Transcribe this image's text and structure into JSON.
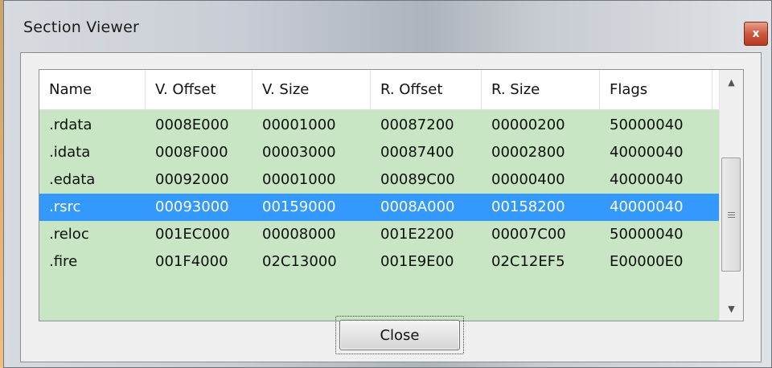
{
  "window": {
    "title": "Section Viewer",
    "close_glyph": "x"
  },
  "table": {
    "columns": [
      "Name",
      "V. Offset",
      "V. Size",
      "R. Offset",
      "R. Size",
      "Flags"
    ],
    "rows": [
      {
        "name": ".rdata",
        "v_offset": "0008E000",
        "v_size": "00001000",
        "r_offset": "00087200",
        "r_size": "00000200",
        "flags": "50000040"
      },
      {
        "name": ".idata",
        "v_offset": "0008F000",
        "v_size": "00003000",
        "r_offset": "00087400",
        "r_size": "00002800",
        "flags": "40000040"
      },
      {
        "name": ".edata",
        "v_offset": "00092000",
        "v_size": "00001000",
        "r_offset": "00089C00",
        "r_size": "00000400",
        "flags": "40000040"
      },
      {
        "name": ".rsrc",
        "v_offset": "00093000",
        "v_size": "00159000",
        "r_offset": "0008A000",
        "r_size": "00158200",
        "flags": "40000040"
      },
      {
        "name": ".reloc",
        "v_offset": "001EC000",
        "v_size": "00008000",
        "r_offset": "001E2200",
        "r_size": "00007C00",
        "flags": "50000040"
      },
      {
        "name": ".fire",
        "v_offset": "001F4000",
        "v_size": "02C13000",
        "r_offset": "001E9E00",
        "r_size": "02C12EF5",
        "flags": "E00000E0"
      }
    ],
    "selected_row": ".rsrc",
    "row_background": "#c8e6c4",
    "selection_color": "#3399ff"
  },
  "buttons": {
    "close_label": "Close"
  },
  "icons": {
    "scroll_up": "chevron-up-icon",
    "scroll_down": "chevron-down-icon",
    "window_close": "close-icon"
  }
}
